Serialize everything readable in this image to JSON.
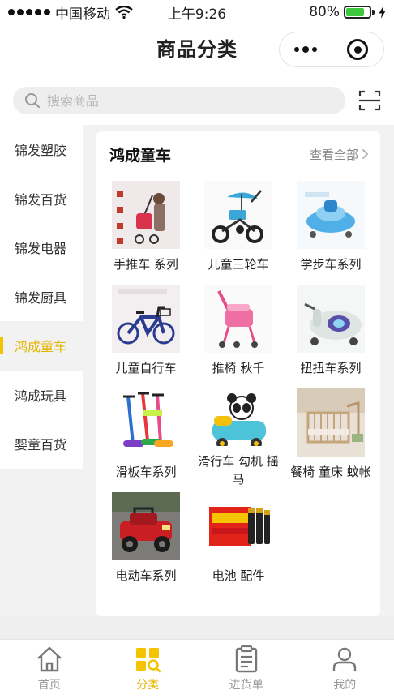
{
  "status_bar": {
    "carrier": "中国移动",
    "time": "上午9:26",
    "battery_percent_label": "80%",
    "battery_level": 0.8
  },
  "nav": {
    "title": "商品分类"
  },
  "search": {
    "placeholder": "搜索商品"
  },
  "sidebar": {
    "items": [
      {
        "label": "锦发塑胶"
      },
      {
        "label": "锦发百货"
      },
      {
        "label": "锦发电器"
      },
      {
        "label": "锦发厨具"
      },
      {
        "label": "鸿成童车",
        "active": true
      },
      {
        "label": "鸿成玩具"
      },
      {
        "label": "婴童百货"
      }
    ]
  },
  "category": {
    "title": "鸿成童车",
    "view_all": "查看全部",
    "products": [
      {
        "label": "手推车 系列",
        "icon": "stroller-icon"
      },
      {
        "label": "儿童三轮车",
        "icon": "tricycle-icon"
      },
      {
        "label": "学步车系列",
        "icon": "walker-icon"
      },
      {
        "label": "儿童自行车",
        "icon": "bicycle-icon"
      },
      {
        "label": "推椅 秋千",
        "icon": "push-chair-icon"
      },
      {
        "label": "扭扭车系列",
        "icon": "swing-car-icon"
      },
      {
        "label": "滑板车系列",
        "icon": "scooter-icon"
      },
      {
        "label": "滑行车 勾机 摇马",
        "icon": "ride-on-toy-icon"
      },
      {
        "label": "餐椅 童床 蚊帐",
        "icon": "crib-icon"
      },
      {
        "label": "电动车系列",
        "icon": "electric-car-icon"
      },
      {
        "label": "电池 配件",
        "icon": "battery-pack-icon"
      }
    ]
  },
  "tabs": [
    {
      "label": "首页",
      "icon": "home-icon"
    },
    {
      "label": "分类",
      "icon": "category-icon",
      "active": true
    },
    {
      "label": "进货单",
      "icon": "order-list-icon"
    },
    {
      "label": "我的",
      "icon": "profile-icon"
    }
  ],
  "colors": {
    "accent": "#f5c400",
    "accent_text": "#e5b400",
    "battery": "#3ec83e"
  }
}
